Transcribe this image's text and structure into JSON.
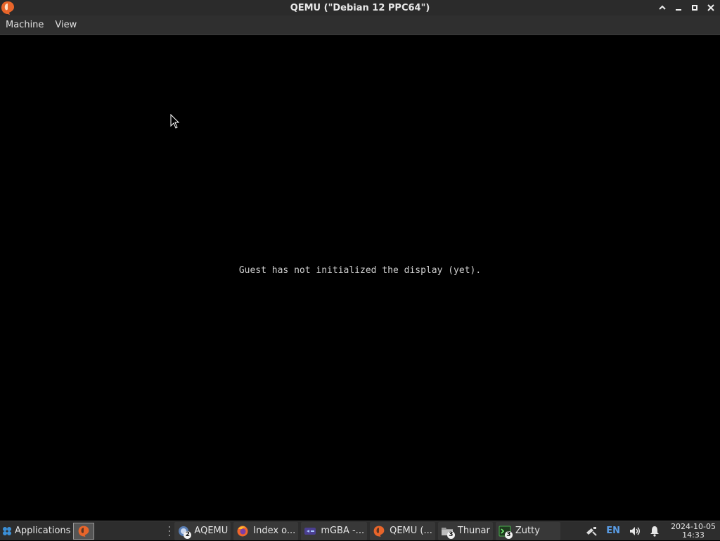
{
  "window": {
    "title": "QEMU (\"Debian 12 PPC64\")"
  },
  "menubar": {
    "items": [
      "Machine",
      "View"
    ]
  },
  "guest": {
    "message": "Guest has not initialized the display (yet)."
  },
  "taskbar": {
    "applications_label": "Applications",
    "tasks": [
      {
        "label": "AQEMU",
        "badge": "2",
        "icon": "aqemu-icon"
      },
      {
        "label": "Index o...",
        "badge": "",
        "icon": "firefox-icon"
      },
      {
        "label": "mGBA -...",
        "badge": "",
        "icon": "mgba-icon"
      },
      {
        "label": "QEMU (...",
        "badge": "",
        "icon": "qemu-icon"
      },
      {
        "label": "Thunar",
        "badge": "3",
        "icon": "folder-icon"
      },
      {
        "label": "Zutty",
        "badge": "3",
        "icon": "terminal-icon"
      }
    ],
    "tray": {
      "language": "EN",
      "date": "2024-10-05",
      "time": "14:33"
    }
  },
  "colors": {
    "titlebar": "#2b2b2b",
    "menubar": "#2f2f2f",
    "taskbar": "#2d2d2d",
    "qemu_orange": "#e8652a",
    "lang_blue": "#5a9ee8"
  }
}
